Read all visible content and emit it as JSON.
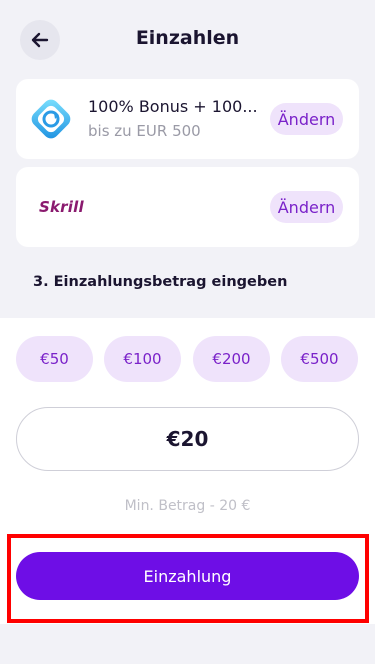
{
  "header": {
    "title": "Einzahlen",
    "back_icon": "arrow-left-icon"
  },
  "bonus": {
    "icon": "bonus-badge-icon",
    "title": "100% Bonus + 100...",
    "subtitle": "bis zu EUR 500",
    "change_label": "Ändern"
  },
  "payment_method": {
    "logo_text": "Skrill",
    "change_label": "Ändern"
  },
  "step": {
    "label": "3. Einzahlungsbetrag eingeben"
  },
  "quick_amounts": [
    "€50",
    "€100",
    "€200",
    "€500"
  ],
  "amount_input": {
    "value": "€20"
  },
  "min_amount": "Min. Betrag - 20 €",
  "deposit_button": {
    "label": "Einzahlung"
  },
  "colors": {
    "accent": "#6e0ee6",
    "chip_bg": "#efe3fb",
    "chip_text": "#7a22c9",
    "highlight": "#ff0000"
  }
}
